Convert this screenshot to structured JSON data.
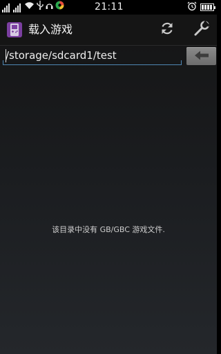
{
  "status_bar": {
    "time": "21:11",
    "network_label": "ıl"
  },
  "app_bar": {
    "title": "载入游戏"
  },
  "path_field": {
    "value": "/storage/sdcard1/test"
  },
  "empty_state": {
    "message": "该目录中没有 GB/GBC 游戏文件."
  },
  "colors": {
    "accent": "#4f87b3",
    "app_icon": "#7b3fa0",
    "background": "#1b1d20"
  },
  "icons": [
    "signal-icon",
    "wifi-icon",
    "usb-icon",
    "alarm-icon",
    "battery-icon",
    "refresh-icon",
    "wrench-icon",
    "back-arrow-icon"
  ]
}
